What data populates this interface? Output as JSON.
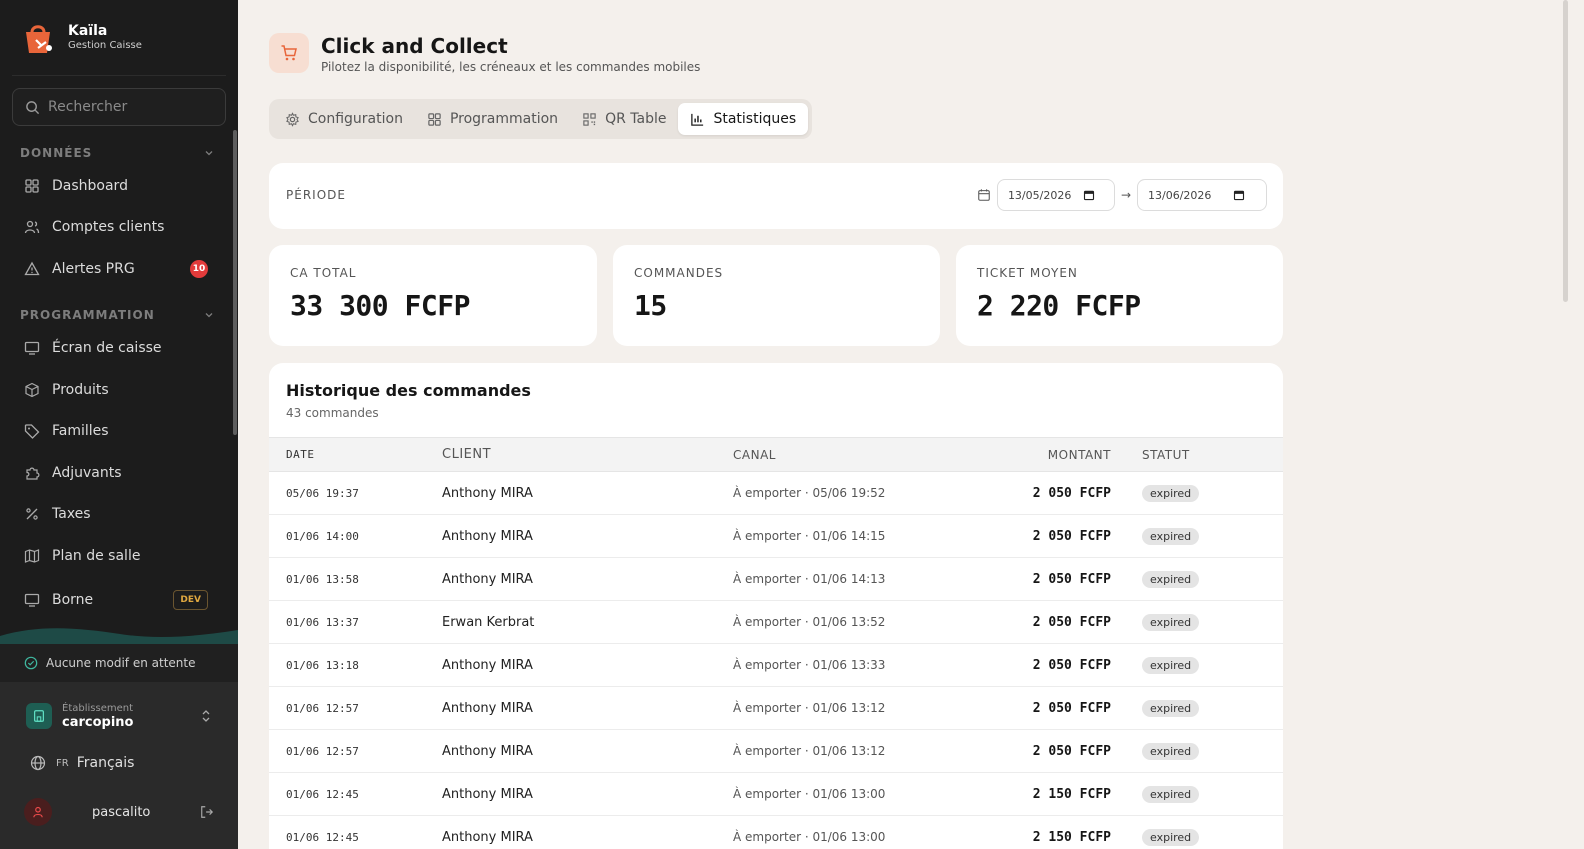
{
  "brand": {
    "name": "Kaïla",
    "subtitle": "Gestion Caisse"
  },
  "search": {
    "placeholder": "Rechercher"
  },
  "sidebar": {
    "section_donnees": "DONNÉES",
    "section_programmation": "PROGRAMMATION",
    "items": [
      {
        "label": "Dashboard"
      },
      {
        "label": "Comptes clients"
      },
      {
        "label": "Alertes PRG",
        "badge": "10"
      },
      {
        "label": "Écran de caisse"
      },
      {
        "label": "Produits"
      },
      {
        "label": "Familles"
      },
      {
        "label": "Adjuvants"
      },
      {
        "label": "Taxes"
      },
      {
        "label": "Plan de salle"
      },
      {
        "label": "Borne",
        "badge": "DEV"
      }
    ],
    "pending": "Aucune modif en attente",
    "establishment_label": "Établissement",
    "establishment_name": "carcopino",
    "lang_code": "FR",
    "lang_name": "Français",
    "user_name": "pascalito"
  },
  "header": {
    "title": "Click and Collect",
    "subtitle": "Pilotez la disponibilité, les créneaux et les commandes mobiles"
  },
  "tabs": [
    {
      "label": "Configuration"
    },
    {
      "label": "Programmation"
    },
    {
      "label": "QR Table"
    },
    {
      "label": "Statistiques",
      "active": true
    }
  ],
  "period": {
    "label": "PÉRIODE",
    "from": "13/05/2026",
    "arrow": "→",
    "to": "13/06/2026"
  },
  "kpis": [
    {
      "label": "CA TOTAL",
      "value": "33 300 FCFP"
    },
    {
      "label": "COMMANDES",
      "value": "15"
    },
    {
      "label": "TICKET MOYEN",
      "value": "2 220 FCFP"
    }
  ],
  "history": {
    "title": "Historique des commandes",
    "count": "43 commandes",
    "columns": {
      "date": "DATE",
      "client": "CLIENT",
      "canal": "CANAL",
      "amount": "MONTANT",
      "status": "STATUT"
    },
    "rows": [
      {
        "date": "05/06 19:37",
        "client": "Anthony MIRA",
        "canal": "À emporter · 05/06 19:52",
        "amount": "2 050 FCFP",
        "status": "expired"
      },
      {
        "date": "01/06 14:00",
        "client": "Anthony MIRA",
        "canal": "À emporter · 01/06 14:15",
        "amount": "2 050 FCFP",
        "status": "expired"
      },
      {
        "date": "01/06 13:58",
        "client": "Anthony MIRA",
        "canal": "À emporter · 01/06 14:13",
        "amount": "2 050 FCFP",
        "status": "expired"
      },
      {
        "date": "01/06 13:37",
        "client": "Erwan Kerbrat",
        "canal": "À emporter · 01/06 13:52",
        "amount": "2 050 FCFP",
        "status": "expired"
      },
      {
        "date": "01/06 13:18",
        "client": "Anthony MIRA",
        "canal": "À emporter · 01/06 13:33",
        "amount": "2 050 FCFP",
        "status": "expired"
      },
      {
        "date": "01/06 12:57",
        "client": "Anthony MIRA",
        "canal": "À emporter · 01/06 13:12",
        "amount": "2 050 FCFP",
        "status": "expired"
      },
      {
        "date": "01/06 12:57",
        "client": "Anthony MIRA",
        "canal": "À emporter · 01/06 13:12",
        "amount": "2 050 FCFP",
        "status": "expired"
      },
      {
        "date": "01/06 12:45",
        "client": "Anthony MIRA",
        "canal": "À emporter · 01/06 13:00",
        "amount": "2 150 FCFP",
        "status": "expired"
      },
      {
        "date": "01/06 12:45",
        "client": "Anthony MIRA",
        "canal": "À emporter · 01/06 13:00",
        "amount": "2 150 FCFP",
        "status": "expired"
      }
    ]
  },
  "colors": {
    "accent": "#e8653a",
    "sidebar_bg": "#1c1c1c",
    "page_bg": "#f4f0ec",
    "badge_red": "#e23b3b"
  }
}
